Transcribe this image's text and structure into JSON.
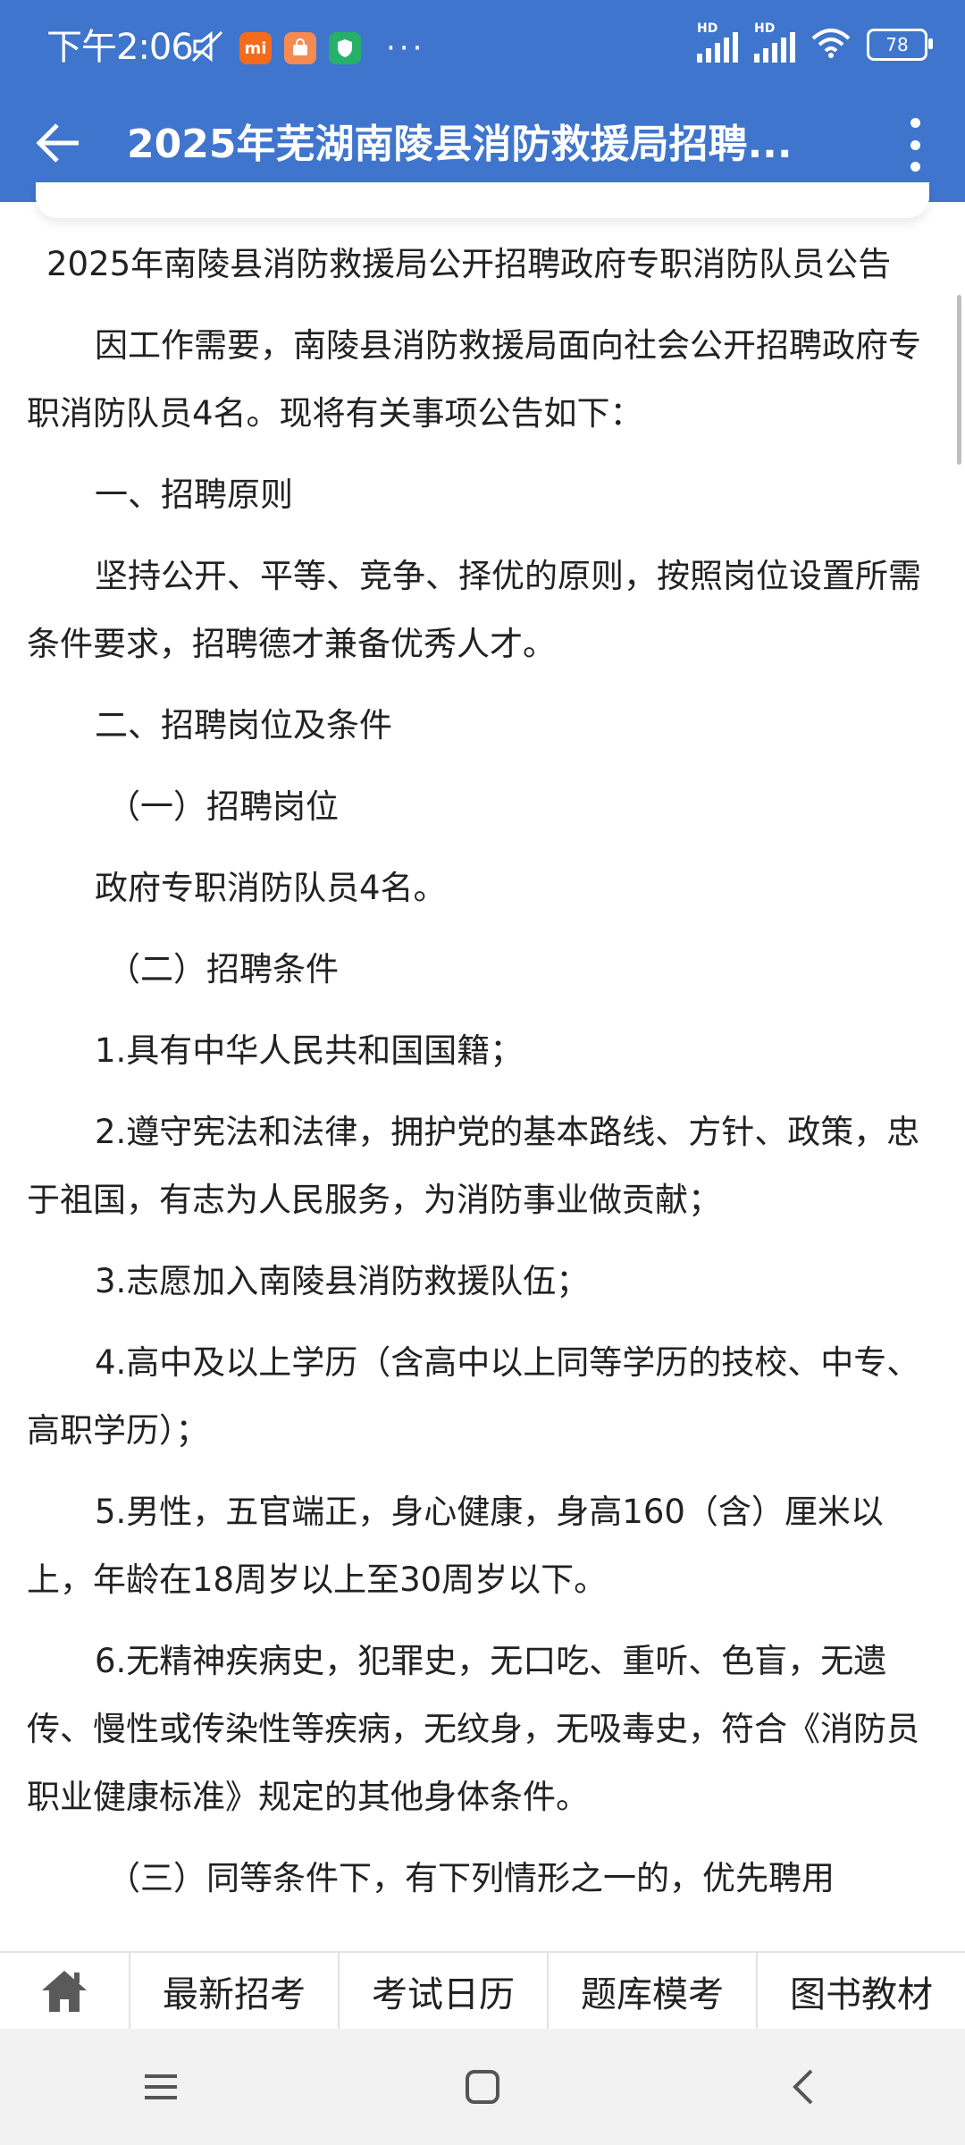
{
  "status_bar": {
    "time": "下午2:06",
    "app_icons": [
      "mi-app-icon",
      "store-icon",
      "security-icon"
    ],
    "battery": "78",
    "signal_label": "HD"
  },
  "app_bar": {
    "title": "2025年芜湖南陵县消防救援局招聘..."
  },
  "article": {
    "heading": "2025年南陵县消防救援局公开招聘政府专职消防队员公告",
    "paragraphs": [
      "因工作需要，南陵县消防救援局面向社会公开招聘政府专职消防队员4名。现将有关事项公告如下：",
      "一、招聘原则",
      "坚持公开、平等、竞争、择优的原则，按照岗位设置所需条件要求，招聘德才兼备优秀人才。",
      "二、招聘岗位及条件",
      "（一）招聘岗位",
      "政府专职消防队员4名。",
      "（二）招聘条件",
      "1.具有中华人民共和国国籍；",
      "2.遵守宪法和法律，拥护党的基本路线、方针、政策，忠于祖国，有志为人民服务，为消防事业做贡献；",
      "3.志愿加入南陵县消防救援队伍；",
      "4.高中及以上学历（含高中以上同等学历的技校、中专、高职学历）；",
      "5.男性，五官端正，身心健康，身高160（含）厘米以上，年龄在18周岁以上至30周岁以下。",
      "6.无精神疾病史，犯罪史，无口吃、重听、色盲，无遗传、慢性或传染性等疾病，无纹身，无吸毒史，符合《消防员职业健康标准》规定的其他身体条件。",
      "（三）同等条件下，有下列情形之一的，优先聘用"
    ]
  },
  "tab_bar": {
    "tabs": [
      "最新招考",
      "考试日历",
      "题库模考",
      "图书教材"
    ]
  },
  "colors": {
    "app_bar": "#3f75cc",
    "text": "#222222",
    "nav_bg": "#f2f2f2"
  }
}
